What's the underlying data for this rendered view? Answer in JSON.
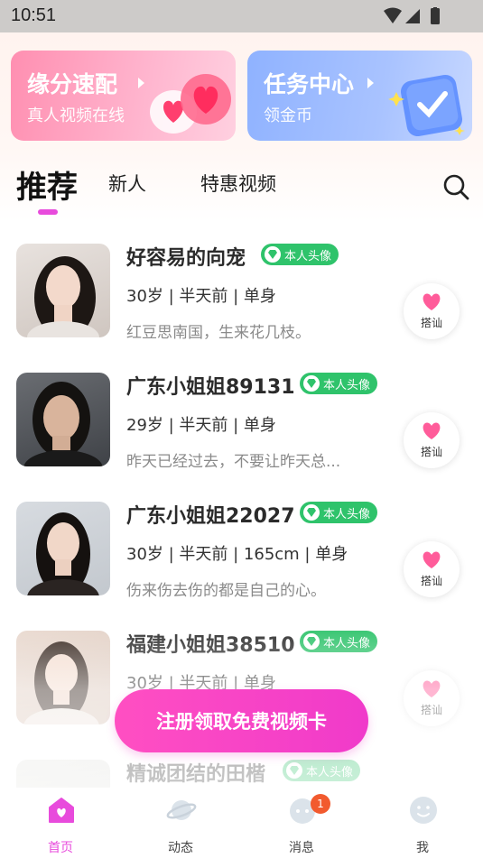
{
  "status_bar": {
    "time": "10:51",
    "icons": [
      "wifi-icon",
      "signal-icon",
      "battery-icon"
    ]
  },
  "banners": [
    {
      "title": "缘分速配",
      "subtitle": "真人视频在线",
      "icon": "hearts-art"
    },
    {
      "title": "任务中心",
      "subtitle": "领金币",
      "icon": "task-cube-art"
    }
  ],
  "tabs": {
    "active": "推荐",
    "items": [
      "新人",
      "特惠视频"
    ],
    "search_icon": "search-icon"
  },
  "users": [
    {
      "name": "好容易的向宠",
      "badge": "本人头像",
      "meta": "30岁 | 半天前 | 单身",
      "bio": "红豆思南国，生来花几枝。",
      "action": "搭讪"
    },
    {
      "name": "广东小姐姐89131",
      "badge": "本人头像",
      "meta": "29岁 | 半天前 | 单身",
      "bio": "昨天已经过去，不要让昨天总...",
      "action": "搭讪"
    },
    {
      "name": "广东小姐姐22027",
      "badge": "本人头像",
      "meta": "30岁 | 半天前 | 165cm | 单身",
      "bio": "伤来伤去伤的都是自己的心。",
      "action": "搭讪"
    },
    {
      "name": "福建小姐姐38510",
      "badge": "本人头像",
      "meta": "30岁 | 半天前 | 单身",
      "bio": "",
      "action": "搭讪"
    },
    {
      "name": "精诚团结的田楷",
      "badge": "本人头像",
      "meta": "",
      "bio": "",
      "action": ""
    }
  ],
  "cta": {
    "label": "注册领取免费视频卡"
  },
  "nav": [
    {
      "label": "首页",
      "icon": "home-icon",
      "active": true
    },
    {
      "label": "动态",
      "icon": "planet-icon"
    },
    {
      "label": "消息",
      "icon": "message-icon",
      "badge": "1"
    },
    {
      "label": "我",
      "icon": "profile-icon"
    }
  ],
  "colors": {
    "accent": "#e84bdc",
    "badge_green": "#2fc36b",
    "cta_pink": "#f03aca"
  }
}
